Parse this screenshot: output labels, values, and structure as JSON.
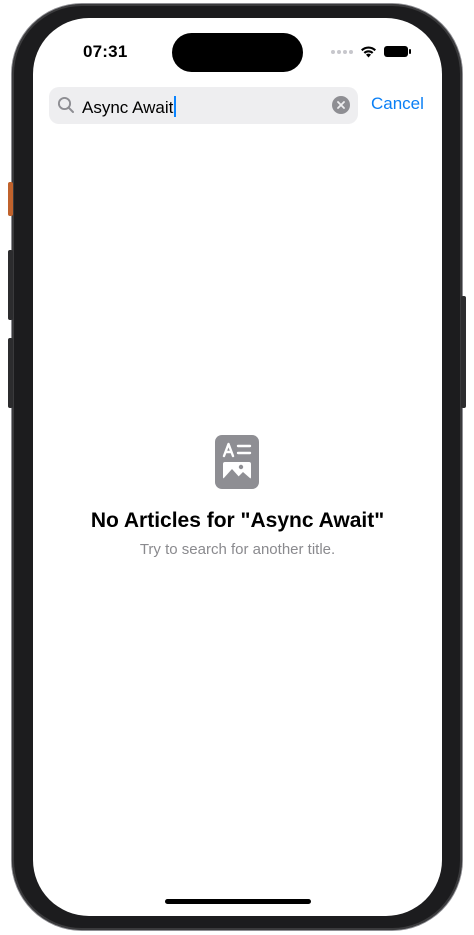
{
  "status_bar": {
    "time": "07:31"
  },
  "search": {
    "query": "Async Await",
    "cancel_label": "Cancel"
  },
  "empty_state": {
    "title": "No Articles for \"Async Await\"",
    "subtitle": "Try to search for another title."
  },
  "colors": {
    "accent": "#0a7ff5",
    "search_bg": "#eeeef0",
    "secondary_text": "#8a8a8e",
    "icon_gray": "#8e8e93"
  }
}
